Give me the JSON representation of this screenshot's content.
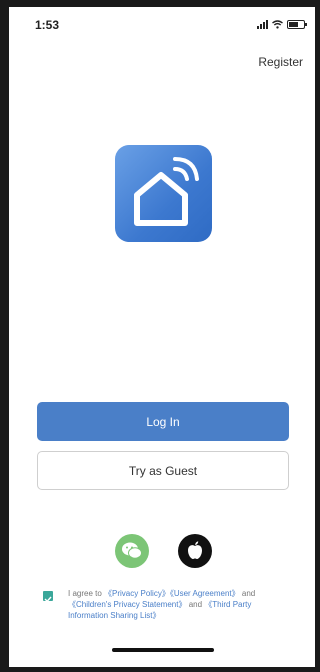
{
  "status_bar": {
    "time": "1:53",
    "icons": [
      "cellular-signal-icon",
      "wifi-icon",
      "battery-icon"
    ]
  },
  "header": {
    "register_label": "Register"
  },
  "logo": {
    "icon": "smart-home-icon",
    "colors": {
      "start": "#6aa0e6",
      "end": "#2f6bc4"
    }
  },
  "actions": {
    "login_label": "Log In",
    "guest_label": "Try as Guest"
  },
  "social_login": {
    "items": [
      {
        "icon": "wechat-icon",
        "color": "#7cc576"
      },
      {
        "icon": "apple-icon",
        "color": "#111111"
      }
    ]
  },
  "agreement": {
    "checked": true,
    "prefix": "I agree to ",
    "privacy_policy": "《Privacy Policy》",
    "user_agreement": "《User Agreement》",
    "and_1": " and ",
    "childrens_privacy": "《Children's Privacy Statement》",
    "and_2": " and ",
    "third_party": "《Third Party Information Sharing List》"
  },
  "colors": {
    "accent": "#4a7fc8",
    "checkbox": "#3aa79a"
  }
}
